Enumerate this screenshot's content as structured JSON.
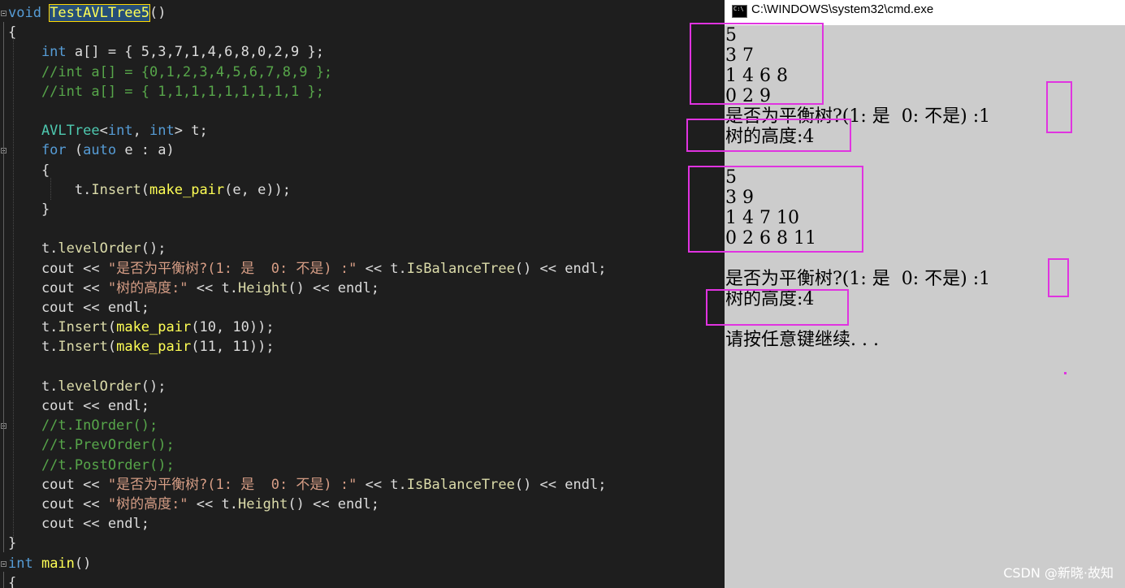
{
  "editor": {
    "lines": [
      [
        [
          "kw",
          "void "
        ],
        [
          "fn hl",
          "TestAVLTree5"
        ],
        [
          "plain",
          "()"
        ]
      ],
      [
        [
          "plain",
          "{"
        ]
      ],
      [
        [
          "kw",
          "    int "
        ],
        [
          "plain",
          "a[] = { 5,3,7,1,4,6,8,0,2,9 };"
        ]
      ],
      [
        [
          "cm",
          "    //int a[] = {0,1,2,3,4,5,6,7,8,9 };"
        ]
      ],
      [
        [
          "cm",
          "    //int a[] = { 1,1,1,1,1,1,1,1,1 };"
        ]
      ],
      [
        [
          "plain",
          ""
        ]
      ],
      [
        [
          "ty",
          "    AVLTree"
        ],
        [
          "plain",
          "<"
        ],
        [
          "kw",
          "int"
        ],
        [
          "plain",
          ", "
        ],
        [
          "kw",
          "int"
        ],
        [
          "plain",
          "> t;"
        ]
      ],
      [
        [
          "kw",
          "    for "
        ],
        [
          "plain",
          "("
        ],
        [
          "kw",
          "auto "
        ],
        [
          "plain",
          "e : a)"
        ]
      ],
      [
        [
          "plain",
          "    {"
        ]
      ],
      [
        [
          "plain",
          "        t."
        ],
        [
          "fn2",
          "Insert"
        ],
        [
          "plain",
          "("
        ],
        [
          "fn",
          "make_pair"
        ],
        [
          "plain",
          "(e, e));"
        ]
      ],
      [
        [
          "plain",
          "    }"
        ]
      ],
      [
        [
          "plain",
          ""
        ]
      ],
      [
        [
          "plain",
          "    t."
        ],
        [
          "fn2",
          "levelOrder"
        ],
        [
          "plain",
          "();"
        ]
      ],
      [
        [
          "plain",
          "    cout << "
        ],
        [
          "str",
          "\"是否为平衡树?(1: 是  0: 不是) :\""
        ],
        [
          "plain",
          " << t."
        ],
        [
          "fn2",
          "IsBalanceTree"
        ],
        [
          "plain",
          "() << endl;"
        ]
      ],
      [
        [
          "plain",
          "    cout << "
        ],
        [
          "str",
          "\"树的高度:\""
        ],
        [
          "plain",
          " << t."
        ],
        [
          "fn2",
          "Height"
        ],
        [
          "plain",
          "() << endl;"
        ]
      ],
      [
        [
          "plain",
          "    cout << endl;"
        ]
      ],
      [
        [
          "plain",
          "    t."
        ],
        [
          "fn2",
          "Insert"
        ],
        [
          "plain",
          "("
        ],
        [
          "fn",
          "make_pair"
        ],
        [
          "plain",
          "(10, 10));"
        ]
      ],
      [
        [
          "plain",
          "    t."
        ],
        [
          "fn2",
          "Insert"
        ],
        [
          "plain",
          "("
        ],
        [
          "fn",
          "make_pair"
        ],
        [
          "plain",
          "(11, 11));"
        ]
      ],
      [
        [
          "plain",
          ""
        ]
      ],
      [
        [
          "plain",
          "    t."
        ],
        [
          "fn2",
          "levelOrder"
        ],
        [
          "plain",
          "();"
        ]
      ],
      [
        [
          "plain",
          "    cout << endl;"
        ]
      ],
      [
        [
          "cm",
          "    //t.InOrder();"
        ]
      ],
      [
        [
          "cm",
          "    //t.PrevOrder();"
        ]
      ],
      [
        [
          "cm",
          "    //t.PostOrder();"
        ]
      ],
      [
        [
          "plain",
          "    cout << "
        ],
        [
          "str",
          "\"是否为平衡树?(1: 是  0: 不是) :\""
        ],
        [
          "plain",
          " << t."
        ],
        [
          "fn2",
          "IsBalanceTree"
        ],
        [
          "plain",
          "() << endl;"
        ]
      ],
      [
        [
          "plain",
          "    cout << "
        ],
        [
          "str",
          "\"树的高度:\""
        ],
        [
          "plain",
          " << t."
        ],
        [
          "fn2",
          "Height"
        ],
        [
          "plain",
          "() << endl;"
        ]
      ],
      [
        [
          "plain",
          "    cout << endl;"
        ]
      ],
      [
        [
          "plain",
          "}"
        ]
      ],
      [
        [
          "kw",
          "int "
        ],
        [
          "fn",
          "main"
        ],
        [
          "plain",
          "()"
        ]
      ],
      [
        [
          "plain",
          "{"
        ]
      ]
    ]
  },
  "console": {
    "title": "C:\\WINDOWS\\system32\\cmd.exe",
    "lines": [
      "5",
      "3 7",
      "1 4 6 8",
      "0 2 9",
      "是否为平衡树?(1: 是  0: 不是) :1",
      "树的高度:4",
      "",
      "5",
      "3 9",
      "1 4 7 10",
      "0 2 6 8 11",
      "",
      "是否为平衡树?(1: 是  0: 不是) :1",
      "树的高度:4",
      "",
      "请按任意键继续. . ."
    ]
  },
  "watermark": "CSDN @新晓·故知",
  "colors": {
    "highlight_box": "#e033e0",
    "console_bg": "#cccccc",
    "editor_bg": "#1e1e1e"
  }
}
